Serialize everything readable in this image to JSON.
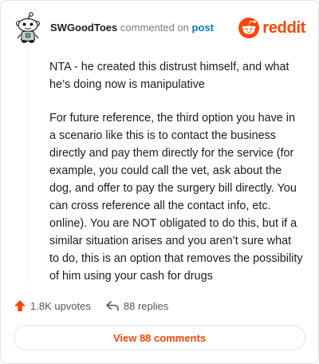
{
  "comment": {
    "username": "SWGoodToes",
    "action_text": "commented on",
    "link_text": "post",
    "paragraphs": [
      "NTA - he created this distrust himself, and what he’s doing now is manipulative",
      "For future reference, the third option you have in a scenario like this is to contact the business directly and pay them directly for the service (for example, you could call the vet, ask about the dog, and offer to pay the surgery bill directly. You can cross reference all the contact info, etc. online). You are NOT obligated to do this, but if a similar situation arises and you aren’t sure what to do, this is an option that removes the possibility of him using your cash for drugs"
    ]
  },
  "brand": {
    "wordmark": "reddit",
    "icon": "reddit-snoo-icon",
    "color": "#ff4500"
  },
  "stats": {
    "upvotes_label": "1.8K upvotes",
    "upvote_icon": "upvote-arrow-icon",
    "replies_label": "88 replies",
    "reply_icon": "reply-arrow-icon"
  },
  "actions": {
    "view_comments_label": "View 88 comments"
  },
  "colors": {
    "accent": "#ff4500",
    "link": "#0079d3",
    "text": "#1c1c1c",
    "muted": "#7c7c7c",
    "border": "#e3e5e8"
  }
}
